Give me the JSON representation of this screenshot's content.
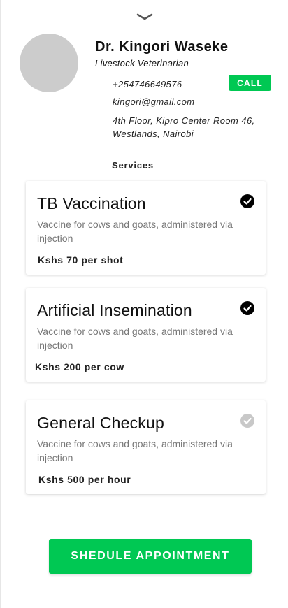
{
  "vet": {
    "name": "Dr. Kingori Waseke",
    "title": "Livestock Veterinarian",
    "phone": "+254746649576",
    "email": "kingori@gmail.com",
    "address": "4th Floor, Kipro Center Room 46, Westlands, Nairobi",
    "call_label": "CALL"
  },
  "services_title": "Services",
  "services": [
    {
      "title": "TB Vaccination",
      "description": "Vaccine for cows and goats, administered via injection",
      "price": "Kshs 70 per shot",
      "selected": true
    },
    {
      "title": "Artificial Insemination",
      "description": "Vaccine for cows and goats, administered via injection",
      "price": "Kshs 200 per cow",
      "selected": true
    },
    {
      "title": "General Checkup",
      "description": "Vaccine for cows and goats, administered via injection",
      "price": "Kshs 500 per hour",
      "selected": false
    }
  ],
  "schedule_label": "SHEDULE APPOINTMENT",
  "colors": {
    "accent": "#00c853",
    "check_selected": "#000000",
    "check_unselected": "#c8c8c8",
    "avatar_placeholder": "#cccccc"
  },
  "icons": {
    "handle": "chevron-down-icon",
    "check": "check-circle-icon"
  }
}
